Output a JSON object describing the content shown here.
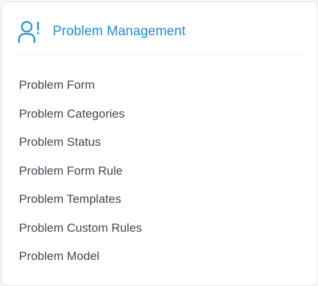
{
  "header": {
    "title": "Problem Management",
    "icon": "user-alert-icon",
    "accent_color": "#1a8fd6"
  },
  "menu": {
    "items": [
      {
        "label": "Problem Form"
      },
      {
        "label": "Problem Categories"
      },
      {
        "label": "Problem Status"
      },
      {
        "label": "Problem Form Rule"
      },
      {
        "label": "Problem Templates"
      },
      {
        "label": "Problem Custom Rules"
      },
      {
        "label": "Problem Model"
      }
    ]
  }
}
